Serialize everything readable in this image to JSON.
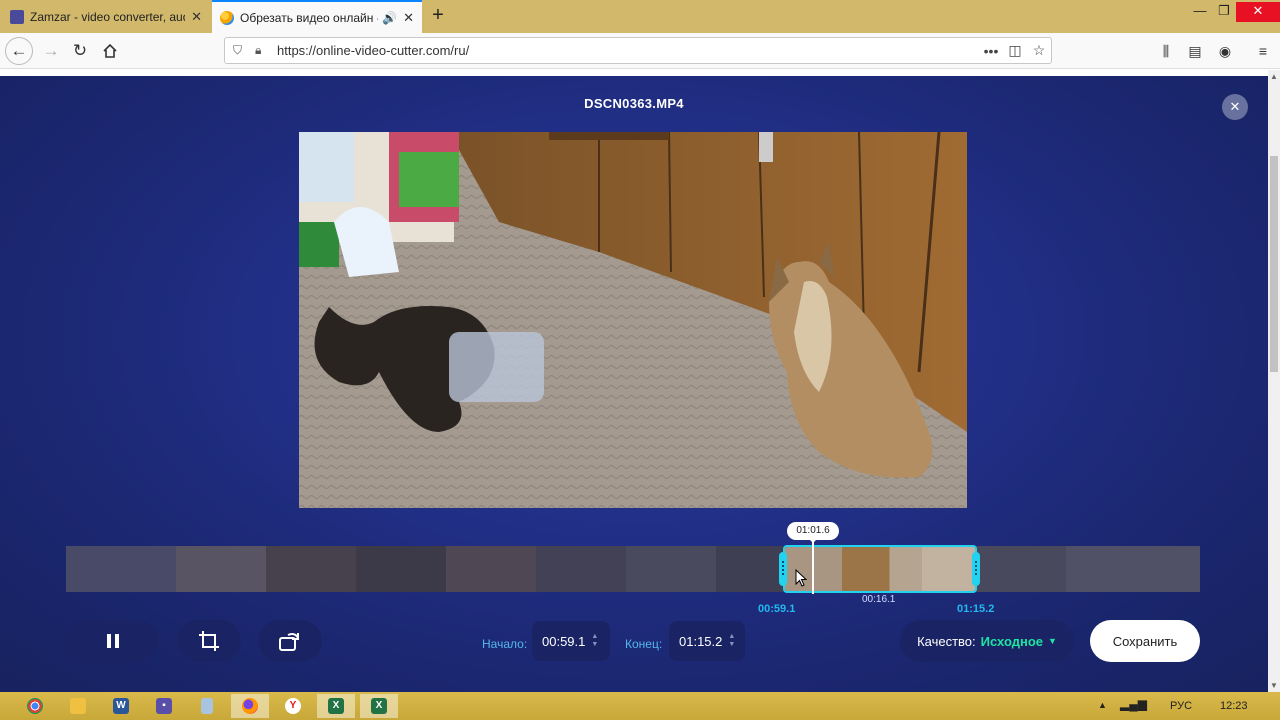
{
  "browser": {
    "tabs": [
      {
        "title": "Zamzar - video converter, audi",
        "active": false
      },
      {
        "title": "Обрезать видео онлайн - с",
        "active": true
      }
    ],
    "url": "https://online-video-cutter.com/ru/",
    "icons": {
      "back": "arrow-left-icon",
      "forward": "arrow-right-icon",
      "reload": "reload-icon",
      "home": "home-icon",
      "shield": "shield-icon",
      "lock": "lock-icon",
      "more": "more-icon",
      "pocket": "pocket-icon",
      "bookmark": "star-icon",
      "library": "library-icon",
      "sidebar": "sidebar-icon",
      "account": "account-icon",
      "menu": "hamburger-icon"
    }
  },
  "editor": {
    "filename": "DSCN0363.MP4",
    "timeline": {
      "playhead_time": "01:01.6",
      "start_time": "00:59.1",
      "duration": "00:16.1",
      "end_time": "01:15.2",
      "selection_start_fraction": 0.63,
      "selection_end_fraction": 0.8,
      "playhead_fraction": 0.655
    },
    "controls": {
      "start_label": "Начало:",
      "start_value": "00:59.1",
      "end_label": "Конец:",
      "end_value": "01:15.2",
      "quality_label": "Качество:",
      "quality_value": "Исходное",
      "save_label": "Сохранить"
    },
    "colors": {
      "accent_cyan": "#22d3f0",
      "quality_green": "#1fe3a0",
      "background_blue": "#22308a"
    }
  },
  "taskbar": {
    "apps": [
      "chrome-icon",
      "folder-icon",
      "word-icon",
      "save-icon",
      "notepad-icon",
      "firefox-icon",
      "yandex-icon",
      "excel-icon",
      "excel-icon"
    ],
    "lang": "РУС",
    "time": "12:23"
  }
}
